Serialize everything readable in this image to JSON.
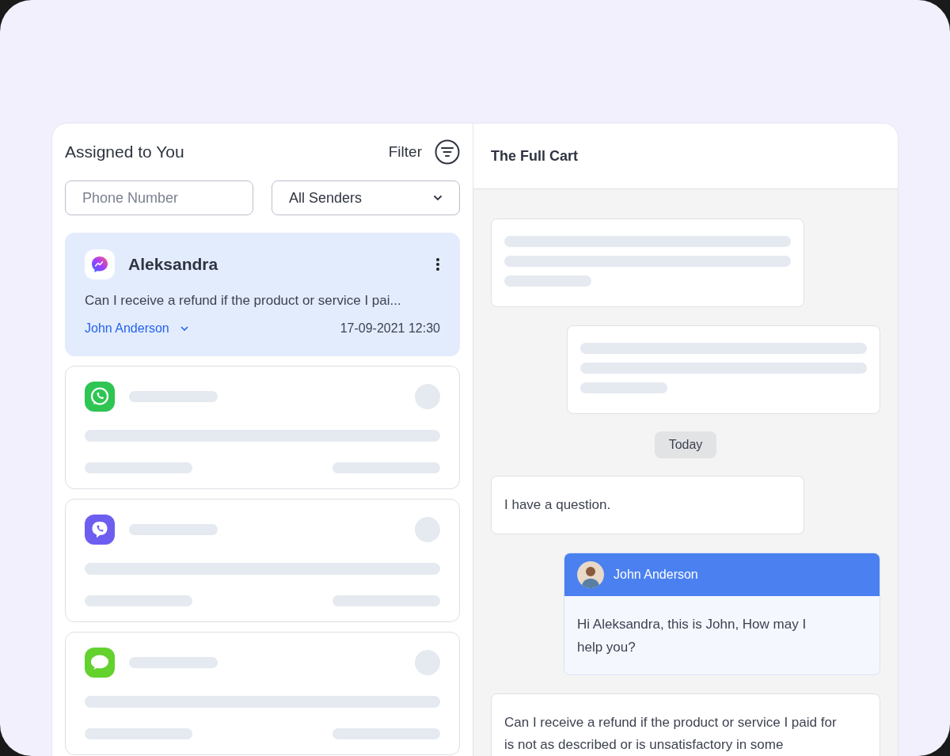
{
  "inbox": {
    "title": "Assigned to You",
    "filter_label": "Filter",
    "phone_field": {
      "placeholder": "Phone Number"
    },
    "sender_select": {
      "value": "All Senders"
    },
    "conversations": [
      {
        "kind": "messenger",
        "loading": false,
        "name": "Aleksandra",
        "preview": "Can I receive a refund if the product or service I pai...",
        "agent": "John Anderson",
        "time": "17-09-2021 12:30",
        "selected": true
      },
      {
        "kind": "whatsapp",
        "loading": true,
        "selected": false
      },
      {
        "kind": "viber",
        "loading": true,
        "selected": false
      },
      {
        "kind": "imessage",
        "loading": true,
        "selected": false
      }
    ]
  },
  "chat": {
    "title": "The Full Cart",
    "items": [
      {
        "kind": "incoming",
        "loading": true
      },
      {
        "kind": "outgoing",
        "loading": true
      },
      {
        "kind": "date",
        "text": "Today"
      },
      {
        "kind": "incoming",
        "text": "I have a question."
      },
      {
        "kind": "outgoing",
        "sender": "John Anderson",
        "text": "Hi Aleksandra, this is John, How may I help you?"
      },
      {
        "kind": "incoming",
        "text": "Can I receive a refund if the product or service I paid for is not as described or is unsatisfactory in some"
      }
    ]
  }
}
